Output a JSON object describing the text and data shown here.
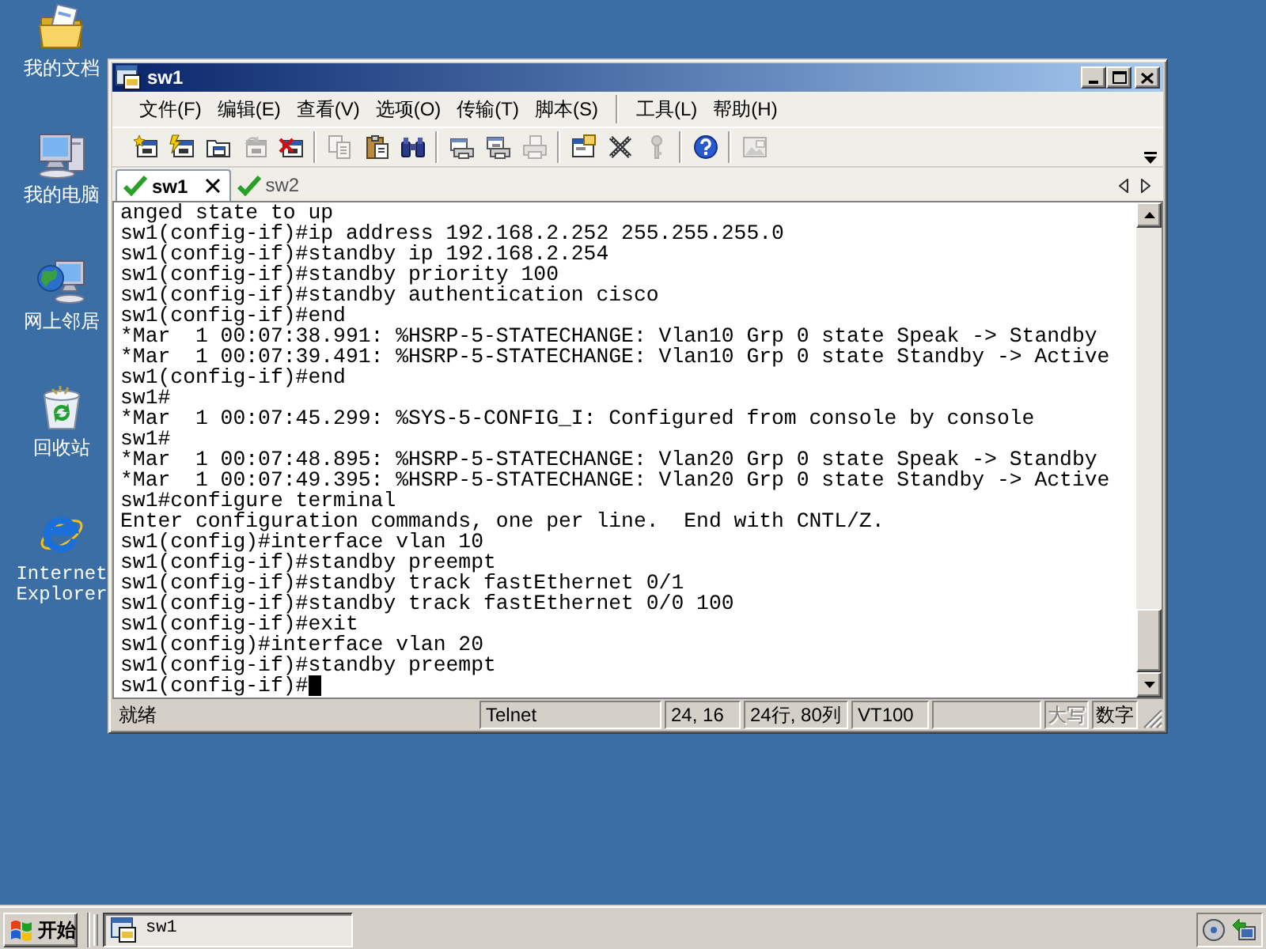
{
  "desktop_icons": [
    {
      "label": "我的文档"
    },
    {
      "label": "我的电脑"
    },
    {
      "label": "网上邻居"
    },
    {
      "label": "回收站"
    },
    {
      "label": "Internet Explorer"
    }
  ],
  "window": {
    "title": "sw1",
    "menu": [
      [
        "文件(F)",
        "编辑(E)",
        "查看(V)",
        "选项(O)",
        "传输(T)",
        "脚本(S)"
      ],
      [
        "工具(L)",
        "帮助(H)"
      ]
    ],
    "toolbar": [
      [
        {
          "disabled": false
        },
        {
          "disabled": false
        },
        {
          "disabled": false
        },
        {
          "disabled": true
        },
        {
          "disabled": false
        }
      ],
      [
        {
          "disabled": true
        },
        {
          "disabled": false
        },
        {
          "disabled": false
        }
      ],
      [
        {
          "disabled": false
        },
        {
          "disabled": false
        },
        {
          "disabled": true
        }
      ],
      [
        {
          "disabled": false
        },
        {
          "disabled": false
        },
        {
          "disabled": true
        }
      ],
      [
        {
          "disabled": false
        }
      ],
      [
        {
          "disabled": true
        }
      ]
    ],
    "tabs": [
      {
        "label": "sw1",
        "selected": true,
        "connected": true
      },
      {
        "label": "sw2",
        "selected": false,
        "connected": true
      }
    ],
    "terminal": {
      "lines": [
        "anged state to up",
        "sw1(config-if)#ip address 192.168.2.252 255.255.255.0",
        "sw1(config-if)#standby ip 192.168.2.254",
        "sw1(config-if)#standby priority 100",
        "sw1(config-if)#standby authentication cisco",
        "sw1(config-if)#end",
        "*Mar  1 00:07:38.991: %HSRP-5-STATECHANGE: Vlan10 Grp 0 state Speak -> Standby",
        "*Mar  1 00:07:39.491: %HSRP-5-STATECHANGE: Vlan10 Grp 0 state Standby -> Active",
        "sw1(config-if)#end",
        "sw1#",
        "*Mar  1 00:07:45.299: %SYS-5-CONFIG_I: Configured from console by console",
        "sw1#",
        "*Mar  1 00:07:48.895: %HSRP-5-STATECHANGE: Vlan20 Grp 0 state Speak -> Standby",
        "*Mar  1 00:07:49.395: %HSRP-5-STATECHANGE: Vlan20 Grp 0 state Standby -> Active",
        "sw1#configure terminal",
        "Enter configuration commands, one per line.  End with CNTL/Z.",
        "sw1(config)#interface vlan 10",
        "sw1(config-if)#standby preempt",
        "sw1(config-if)#standby track fastEthernet 0/1",
        "sw1(config-if)#standby track fastEthernet 0/0 100",
        "sw1(config-if)#exit",
        "sw1(config)#interface vlan 20",
        "sw1(config-if)#standby preempt",
        "sw1(config-if)#"
      ],
      "cursor": true
    },
    "status_bar": {
      "message": "就绪",
      "panes": [
        "Telnet",
        "24, 16",
        "24行, 80列",
        "VT100"
      ],
      "indicators": [
        {
          "label": "大写",
          "on": false
        },
        {
          "label": "数字",
          "on": true
        }
      ]
    }
  },
  "taskbar": {
    "start": "开始",
    "tasks": [
      {
        "label": "sw1",
        "selected": true
      }
    ]
  }
}
